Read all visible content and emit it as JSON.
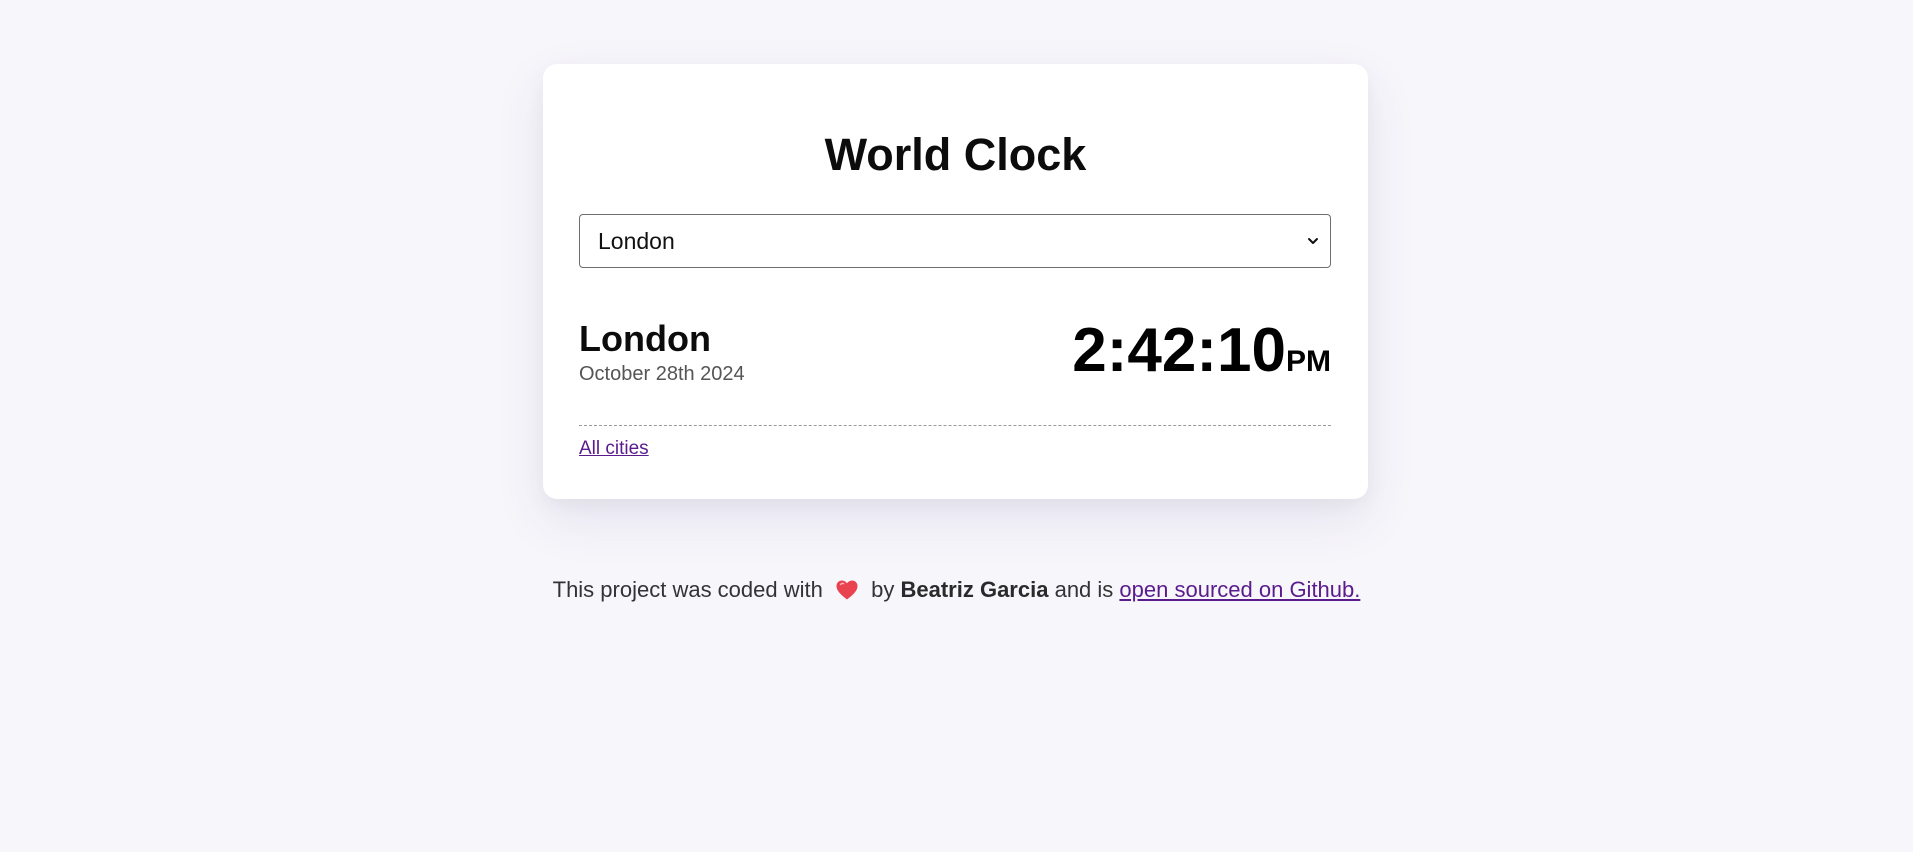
{
  "app": {
    "title": "World Clock"
  },
  "city_select": {
    "selected": "London",
    "icon": "chevron-down-icon"
  },
  "city": {
    "name": "London",
    "date": "October 28th 2024",
    "time": "2:42:10",
    "ampm": "PM"
  },
  "links": {
    "all_cities": "All cities"
  },
  "footer": {
    "prefix": "This project was coded with",
    "heart_icon": "heart-icon",
    "by": "by",
    "author": "Beatriz Garcia",
    "middle": "and is",
    "link_text": "open sourced on Github."
  },
  "colors": {
    "background": "#f7f6fb",
    "card": "#ffffff",
    "link": "#5a1b8c",
    "heart": "#e8434f"
  }
}
